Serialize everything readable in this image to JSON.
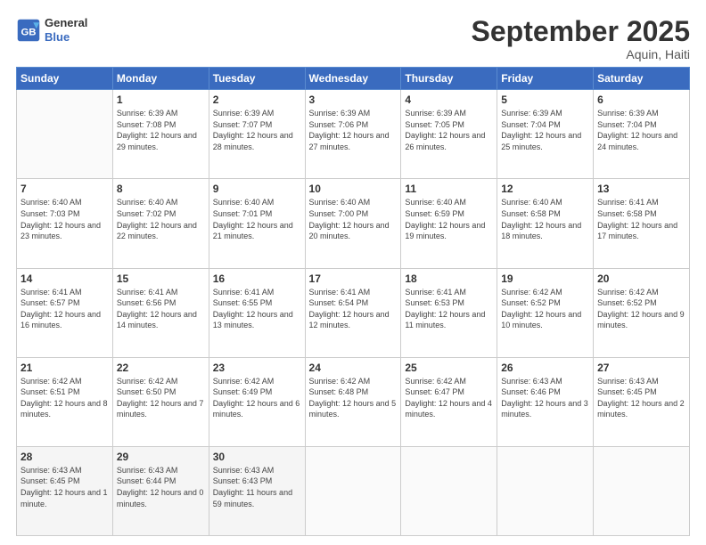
{
  "logo": {
    "line1": "General",
    "line2": "Blue"
  },
  "title": "September 2025",
  "location": "Aquin, Haiti",
  "days_header": [
    "Sunday",
    "Monday",
    "Tuesday",
    "Wednesday",
    "Thursday",
    "Friday",
    "Saturday"
  ],
  "weeks": [
    [
      {
        "day": "",
        "sunrise": "",
        "sunset": "",
        "daylight": ""
      },
      {
        "day": "1",
        "sunrise": "Sunrise: 6:39 AM",
        "sunset": "Sunset: 7:08 PM",
        "daylight": "Daylight: 12 hours and 29 minutes."
      },
      {
        "day": "2",
        "sunrise": "Sunrise: 6:39 AM",
        "sunset": "Sunset: 7:07 PM",
        "daylight": "Daylight: 12 hours and 28 minutes."
      },
      {
        "day": "3",
        "sunrise": "Sunrise: 6:39 AM",
        "sunset": "Sunset: 7:06 PM",
        "daylight": "Daylight: 12 hours and 27 minutes."
      },
      {
        "day": "4",
        "sunrise": "Sunrise: 6:39 AM",
        "sunset": "Sunset: 7:05 PM",
        "daylight": "Daylight: 12 hours and 26 minutes."
      },
      {
        "day": "5",
        "sunrise": "Sunrise: 6:39 AM",
        "sunset": "Sunset: 7:04 PM",
        "daylight": "Daylight: 12 hours and 25 minutes."
      },
      {
        "day": "6",
        "sunrise": "Sunrise: 6:39 AM",
        "sunset": "Sunset: 7:04 PM",
        "daylight": "Daylight: 12 hours and 24 minutes."
      }
    ],
    [
      {
        "day": "7",
        "sunrise": "Sunrise: 6:40 AM",
        "sunset": "Sunset: 7:03 PM",
        "daylight": "Daylight: 12 hours and 23 minutes."
      },
      {
        "day": "8",
        "sunrise": "Sunrise: 6:40 AM",
        "sunset": "Sunset: 7:02 PM",
        "daylight": "Daylight: 12 hours and 22 minutes."
      },
      {
        "day": "9",
        "sunrise": "Sunrise: 6:40 AM",
        "sunset": "Sunset: 7:01 PM",
        "daylight": "Daylight: 12 hours and 21 minutes."
      },
      {
        "day": "10",
        "sunrise": "Sunrise: 6:40 AM",
        "sunset": "Sunset: 7:00 PM",
        "daylight": "Daylight: 12 hours and 20 minutes."
      },
      {
        "day": "11",
        "sunrise": "Sunrise: 6:40 AM",
        "sunset": "Sunset: 6:59 PM",
        "daylight": "Daylight: 12 hours and 19 minutes."
      },
      {
        "day": "12",
        "sunrise": "Sunrise: 6:40 AM",
        "sunset": "Sunset: 6:58 PM",
        "daylight": "Daylight: 12 hours and 18 minutes."
      },
      {
        "day": "13",
        "sunrise": "Sunrise: 6:41 AM",
        "sunset": "Sunset: 6:58 PM",
        "daylight": "Daylight: 12 hours and 17 minutes."
      }
    ],
    [
      {
        "day": "14",
        "sunrise": "Sunrise: 6:41 AM",
        "sunset": "Sunset: 6:57 PM",
        "daylight": "Daylight: 12 hours and 16 minutes."
      },
      {
        "day": "15",
        "sunrise": "Sunrise: 6:41 AM",
        "sunset": "Sunset: 6:56 PM",
        "daylight": "Daylight: 12 hours and 14 minutes."
      },
      {
        "day": "16",
        "sunrise": "Sunrise: 6:41 AM",
        "sunset": "Sunset: 6:55 PM",
        "daylight": "Daylight: 12 hours and 13 minutes."
      },
      {
        "day": "17",
        "sunrise": "Sunrise: 6:41 AM",
        "sunset": "Sunset: 6:54 PM",
        "daylight": "Daylight: 12 hours and 12 minutes."
      },
      {
        "day": "18",
        "sunrise": "Sunrise: 6:41 AM",
        "sunset": "Sunset: 6:53 PM",
        "daylight": "Daylight: 12 hours and 11 minutes."
      },
      {
        "day": "19",
        "sunrise": "Sunrise: 6:42 AM",
        "sunset": "Sunset: 6:52 PM",
        "daylight": "Daylight: 12 hours and 10 minutes."
      },
      {
        "day": "20",
        "sunrise": "Sunrise: 6:42 AM",
        "sunset": "Sunset: 6:52 PM",
        "daylight": "Daylight: 12 hours and 9 minutes."
      }
    ],
    [
      {
        "day": "21",
        "sunrise": "Sunrise: 6:42 AM",
        "sunset": "Sunset: 6:51 PM",
        "daylight": "Daylight: 12 hours and 8 minutes."
      },
      {
        "day": "22",
        "sunrise": "Sunrise: 6:42 AM",
        "sunset": "Sunset: 6:50 PM",
        "daylight": "Daylight: 12 hours and 7 minutes."
      },
      {
        "day": "23",
        "sunrise": "Sunrise: 6:42 AM",
        "sunset": "Sunset: 6:49 PM",
        "daylight": "Daylight: 12 hours and 6 minutes."
      },
      {
        "day": "24",
        "sunrise": "Sunrise: 6:42 AM",
        "sunset": "Sunset: 6:48 PM",
        "daylight": "Daylight: 12 hours and 5 minutes."
      },
      {
        "day": "25",
        "sunrise": "Sunrise: 6:42 AM",
        "sunset": "Sunset: 6:47 PM",
        "daylight": "Daylight: 12 hours and 4 minutes."
      },
      {
        "day": "26",
        "sunrise": "Sunrise: 6:43 AM",
        "sunset": "Sunset: 6:46 PM",
        "daylight": "Daylight: 12 hours and 3 minutes."
      },
      {
        "day": "27",
        "sunrise": "Sunrise: 6:43 AM",
        "sunset": "Sunset: 6:45 PM",
        "daylight": "Daylight: 12 hours and 2 minutes."
      }
    ],
    [
      {
        "day": "28",
        "sunrise": "Sunrise: 6:43 AM",
        "sunset": "Sunset: 6:45 PM",
        "daylight": "Daylight: 12 hours and 1 minute."
      },
      {
        "day": "29",
        "sunrise": "Sunrise: 6:43 AM",
        "sunset": "Sunset: 6:44 PM",
        "daylight": "Daylight: 12 hours and 0 minutes."
      },
      {
        "day": "30",
        "sunrise": "Sunrise: 6:43 AM",
        "sunset": "Sunset: 6:43 PM",
        "daylight": "Daylight: 11 hours and 59 minutes."
      },
      {
        "day": "",
        "sunrise": "",
        "sunset": "",
        "daylight": ""
      },
      {
        "day": "",
        "sunrise": "",
        "sunset": "",
        "daylight": ""
      },
      {
        "day": "",
        "sunrise": "",
        "sunset": "",
        "daylight": ""
      },
      {
        "day": "",
        "sunrise": "",
        "sunset": "",
        "daylight": ""
      }
    ]
  ]
}
